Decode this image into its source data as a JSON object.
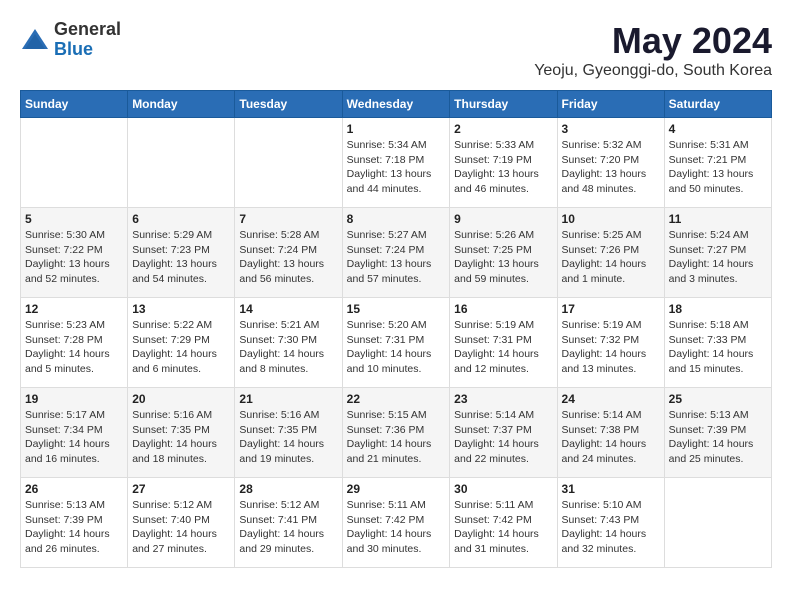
{
  "logo": {
    "general": "General",
    "blue": "Blue"
  },
  "title": "May 2024",
  "location": "Yeoju, Gyeonggi-do, South Korea",
  "days_of_week": [
    "Sunday",
    "Monday",
    "Tuesday",
    "Wednesday",
    "Thursday",
    "Friday",
    "Saturday"
  ],
  "weeks": [
    [
      {
        "day": "",
        "sunrise": "",
        "sunset": "",
        "daylight": ""
      },
      {
        "day": "",
        "sunrise": "",
        "sunset": "",
        "daylight": ""
      },
      {
        "day": "",
        "sunrise": "",
        "sunset": "",
        "daylight": ""
      },
      {
        "day": "1",
        "sunrise": "Sunrise: 5:34 AM",
        "sunset": "Sunset: 7:18 PM",
        "daylight": "Daylight: 13 hours and 44 minutes."
      },
      {
        "day": "2",
        "sunrise": "Sunrise: 5:33 AM",
        "sunset": "Sunset: 7:19 PM",
        "daylight": "Daylight: 13 hours and 46 minutes."
      },
      {
        "day": "3",
        "sunrise": "Sunrise: 5:32 AM",
        "sunset": "Sunset: 7:20 PM",
        "daylight": "Daylight: 13 hours and 48 minutes."
      },
      {
        "day": "4",
        "sunrise": "Sunrise: 5:31 AM",
        "sunset": "Sunset: 7:21 PM",
        "daylight": "Daylight: 13 hours and 50 minutes."
      }
    ],
    [
      {
        "day": "5",
        "sunrise": "Sunrise: 5:30 AM",
        "sunset": "Sunset: 7:22 PM",
        "daylight": "Daylight: 13 hours and 52 minutes."
      },
      {
        "day": "6",
        "sunrise": "Sunrise: 5:29 AM",
        "sunset": "Sunset: 7:23 PM",
        "daylight": "Daylight: 13 hours and 54 minutes."
      },
      {
        "day": "7",
        "sunrise": "Sunrise: 5:28 AM",
        "sunset": "Sunset: 7:24 PM",
        "daylight": "Daylight: 13 hours and 56 minutes."
      },
      {
        "day": "8",
        "sunrise": "Sunrise: 5:27 AM",
        "sunset": "Sunset: 7:24 PM",
        "daylight": "Daylight: 13 hours and 57 minutes."
      },
      {
        "day": "9",
        "sunrise": "Sunrise: 5:26 AM",
        "sunset": "Sunset: 7:25 PM",
        "daylight": "Daylight: 13 hours and 59 minutes."
      },
      {
        "day": "10",
        "sunrise": "Sunrise: 5:25 AM",
        "sunset": "Sunset: 7:26 PM",
        "daylight": "Daylight: 14 hours and 1 minute."
      },
      {
        "day": "11",
        "sunrise": "Sunrise: 5:24 AM",
        "sunset": "Sunset: 7:27 PM",
        "daylight": "Daylight: 14 hours and 3 minutes."
      }
    ],
    [
      {
        "day": "12",
        "sunrise": "Sunrise: 5:23 AM",
        "sunset": "Sunset: 7:28 PM",
        "daylight": "Daylight: 14 hours and 5 minutes."
      },
      {
        "day": "13",
        "sunrise": "Sunrise: 5:22 AM",
        "sunset": "Sunset: 7:29 PM",
        "daylight": "Daylight: 14 hours and 6 minutes."
      },
      {
        "day": "14",
        "sunrise": "Sunrise: 5:21 AM",
        "sunset": "Sunset: 7:30 PM",
        "daylight": "Daylight: 14 hours and 8 minutes."
      },
      {
        "day": "15",
        "sunrise": "Sunrise: 5:20 AM",
        "sunset": "Sunset: 7:31 PM",
        "daylight": "Daylight: 14 hours and 10 minutes."
      },
      {
        "day": "16",
        "sunrise": "Sunrise: 5:19 AM",
        "sunset": "Sunset: 7:31 PM",
        "daylight": "Daylight: 14 hours and 12 minutes."
      },
      {
        "day": "17",
        "sunrise": "Sunrise: 5:19 AM",
        "sunset": "Sunset: 7:32 PM",
        "daylight": "Daylight: 14 hours and 13 minutes."
      },
      {
        "day": "18",
        "sunrise": "Sunrise: 5:18 AM",
        "sunset": "Sunset: 7:33 PM",
        "daylight": "Daylight: 14 hours and 15 minutes."
      }
    ],
    [
      {
        "day": "19",
        "sunrise": "Sunrise: 5:17 AM",
        "sunset": "Sunset: 7:34 PM",
        "daylight": "Daylight: 14 hours and 16 minutes."
      },
      {
        "day": "20",
        "sunrise": "Sunrise: 5:16 AM",
        "sunset": "Sunset: 7:35 PM",
        "daylight": "Daylight: 14 hours and 18 minutes."
      },
      {
        "day": "21",
        "sunrise": "Sunrise: 5:16 AM",
        "sunset": "Sunset: 7:35 PM",
        "daylight": "Daylight: 14 hours and 19 minutes."
      },
      {
        "day": "22",
        "sunrise": "Sunrise: 5:15 AM",
        "sunset": "Sunset: 7:36 PM",
        "daylight": "Daylight: 14 hours and 21 minutes."
      },
      {
        "day": "23",
        "sunrise": "Sunrise: 5:14 AM",
        "sunset": "Sunset: 7:37 PM",
        "daylight": "Daylight: 14 hours and 22 minutes."
      },
      {
        "day": "24",
        "sunrise": "Sunrise: 5:14 AM",
        "sunset": "Sunset: 7:38 PM",
        "daylight": "Daylight: 14 hours and 24 minutes."
      },
      {
        "day": "25",
        "sunrise": "Sunrise: 5:13 AM",
        "sunset": "Sunset: 7:39 PM",
        "daylight": "Daylight: 14 hours and 25 minutes."
      }
    ],
    [
      {
        "day": "26",
        "sunrise": "Sunrise: 5:13 AM",
        "sunset": "Sunset: 7:39 PM",
        "daylight": "Daylight: 14 hours and 26 minutes."
      },
      {
        "day": "27",
        "sunrise": "Sunrise: 5:12 AM",
        "sunset": "Sunset: 7:40 PM",
        "daylight": "Daylight: 14 hours and 27 minutes."
      },
      {
        "day": "28",
        "sunrise": "Sunrise: 5:12 AM",
        "sunset": "Sunset: 7:41 PM",
        "daylight": "Daylight: 14 hours and 29 minutes."
      },
      {
        "day": "29",
        "sunrise": "Sunrise: 5:11 AM",
        "sunset": "Sunset: 7:42 PM",
        "daylight": "Daylight: 14 hours and 30 minutes."
      },
      {
        "day": "30",
        "sunrise": "Sunrise: 5:11 AM",
        "sunset": "Sunset: 7:42 PM",
        "daylight": "Daylight: 14 hours and 31 minutes."
      },
      {
        "day": "31",
        "sunrise": "Sunrise: 5:10 AM",
        "sunset": "Sunset: 7:43 PM",
        "daylight": "Daylight: 14 hours and 32 minutes."
      },
      {
        "day": "",
        "sunrise": "",
        "sunset": "",
        "daylight": ""
      }
    ]
  ]
}
